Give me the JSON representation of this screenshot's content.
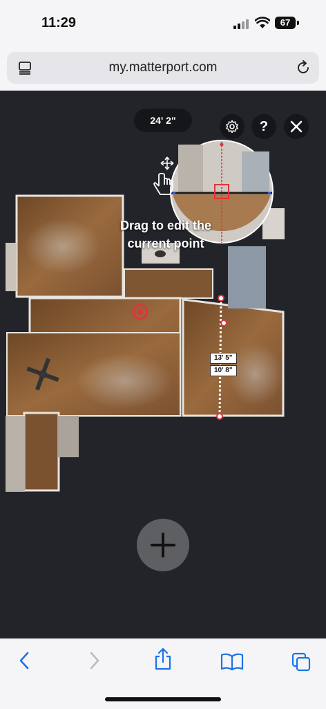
{
  "status_bar": {
    "time": "11:29",
    "battery": "67"
  },
  "browser": {
    "url": "my.matterport.com"
  },
  "measure": {
    "total_length": "24' 2\"",
    "hint": "Drag to edit the current point",
    "segment_labels": [
      "13' 5\"",
      "10' 8\""
    ]
  },
  "icons": {
    "reader": "reader-mode-icon",
    "reload": "reload-icon",
    "settings": "gear-icon",
    "help": "help-icon",
    "close": "close-icon",
    "move": "move-icon",
    "hand": "hand-pointer-icon",
    "add": "plus-icon",
    "back": "chevron-left-icon",
    "forward": "chevron-right-icon",
    "share": "share-icon",
    "bookmarks": "book-icon",
    "tabs": "tabs-icon"
  },
  "colors": {
    "accent": "#e0343c",
    "floor": "#8a5d35",
    "viewer_bg": "#23242a"
  }
}
